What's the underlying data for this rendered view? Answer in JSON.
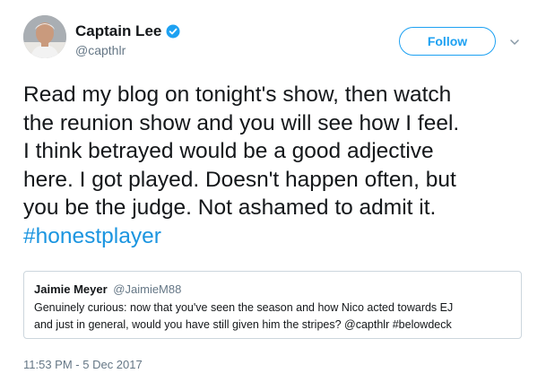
{
  "author": {
    "display_name": "Captain Lee",
    "handle": "@capthlr",
    "verified": true,
    "avatar_icon": "person-avatar"
  },
  "follow_button": {
    "label": "Follow"
  },
  "menu_icon": "chevron-down-icon",
  "tweet": {
    "lines": [
      "Read my blog on tonight's show, then watch",
      "the reunion show and you will see how I feel.",
      "I think betrayed would be a good adjective",
      "here. I got played. Doesn't happen often, but",
      "you be the judge. Not ashamed to admit it."
    ],
    "hashtag": "#honestplayer"
  },
  "quoted_tweet": {
    "display_name": "Jaimie Meyer",
    "handle": "@JaimieM88",
    "lines": [
      "Genuinely curious: now that you've seen the season and how Nico acted towards EJ",
      "and just in general, would you have still given him the stripes? @capthlr #belowdeck"
    ]
  },
  "timestamp": "11:53 PM - 5 Dec 2017",
  "colors": {
    "accent": "#1da1f2",
    "link": "#1b95e0",
    "secondary_text": "#657786",
    "border": "#ccd6dd"
  }
}
